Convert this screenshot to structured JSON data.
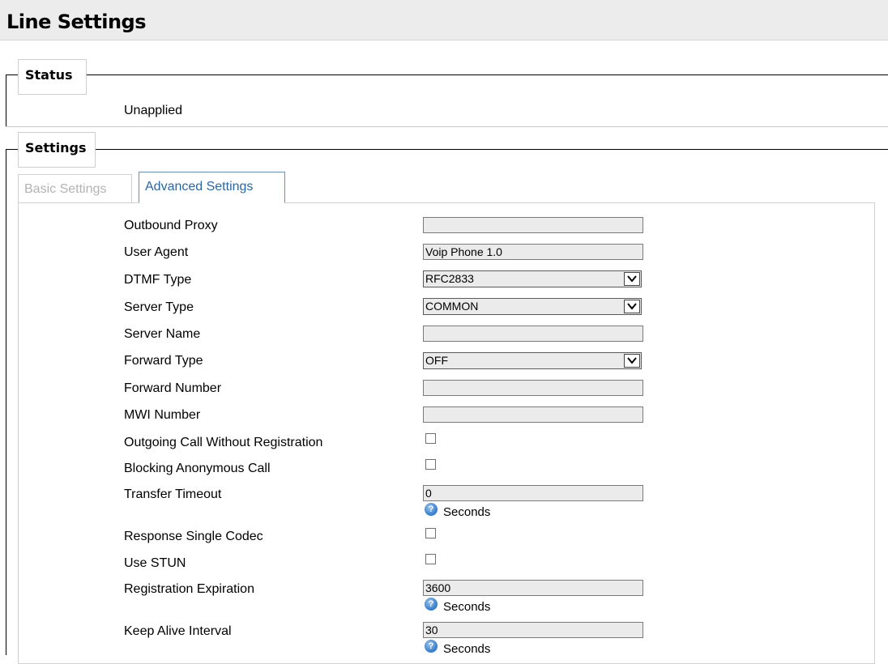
{
  "page": {
    "title": "Line Settings"
  },
  "status": {
    "legend": "Status",
    "value": "Unapplied"
  },
  "settings": {
    "legend": "Settings",
    "tabs": [
      {
        "label": "Basic Settings",
        "active": false
      },
      {
        "label": "Advanced Settings",
        "active": true
      }
    ]
  },
  "form": {
    "outbound_proxy": {
      "label": "Outbound Proxy",
      "value": ""
    },
    "user_agent": {
      "label": "User Agent",
      "value": "Voip Phone 1.0"
    },
    "dtmf_type": {
      "label": "DTMF Type",
      "value": "RFC2833"
    },
    "server_type": {
      "label": "Server Type",
      "value": "COMMON"
    },
    "server_name": {
      "label": "Server Name",
      "value": ""
    },
    "forward_type": {
      "label": "Forward Type",
      "value": "OFF"
    },
    "forward_number": {
      "label": "Forward Number",
      "value": ""
    },
    "mwi_number": {
      "label": "MWI Number",
      "value": ""
    },
    "outgoing_without_registration": {
      "label": "Outgoing Call Without Registration",
      "checked": false
    },
    "blocking_anonymous": {
      "label": "Blocking Anonymous Call",
      "checked": false
    },
    "transfer_timeout": {
      "label": "Transfer Timeout",
      "value": "0",
      "unit": "Seconds"
    },
    "response_single_codec": {
      "label": "Response Single Codec",
      "checked": false
    },
    "use_stun": {
      "label": "Use STUN",
      "checked": false
    },
    "registration_expiration": {
      "label": "Registration Expiration",
      "value": "3600",
      "unit": "Seconds"
    },
    "keep_alive_interval": {
      "label": "Keep Alive Interval",
      "value": "30",
      "unit": "Seconds"
    }
  },
  "icons": {
    "help": "?",
    "caret": "chevron-down-icon"
  },
  "colors": {
    "active_tab": "#2b66a6",
    "inactive_tab": "#b3b3b3",
    "help_icon": "#3e83cf"
  }
}
